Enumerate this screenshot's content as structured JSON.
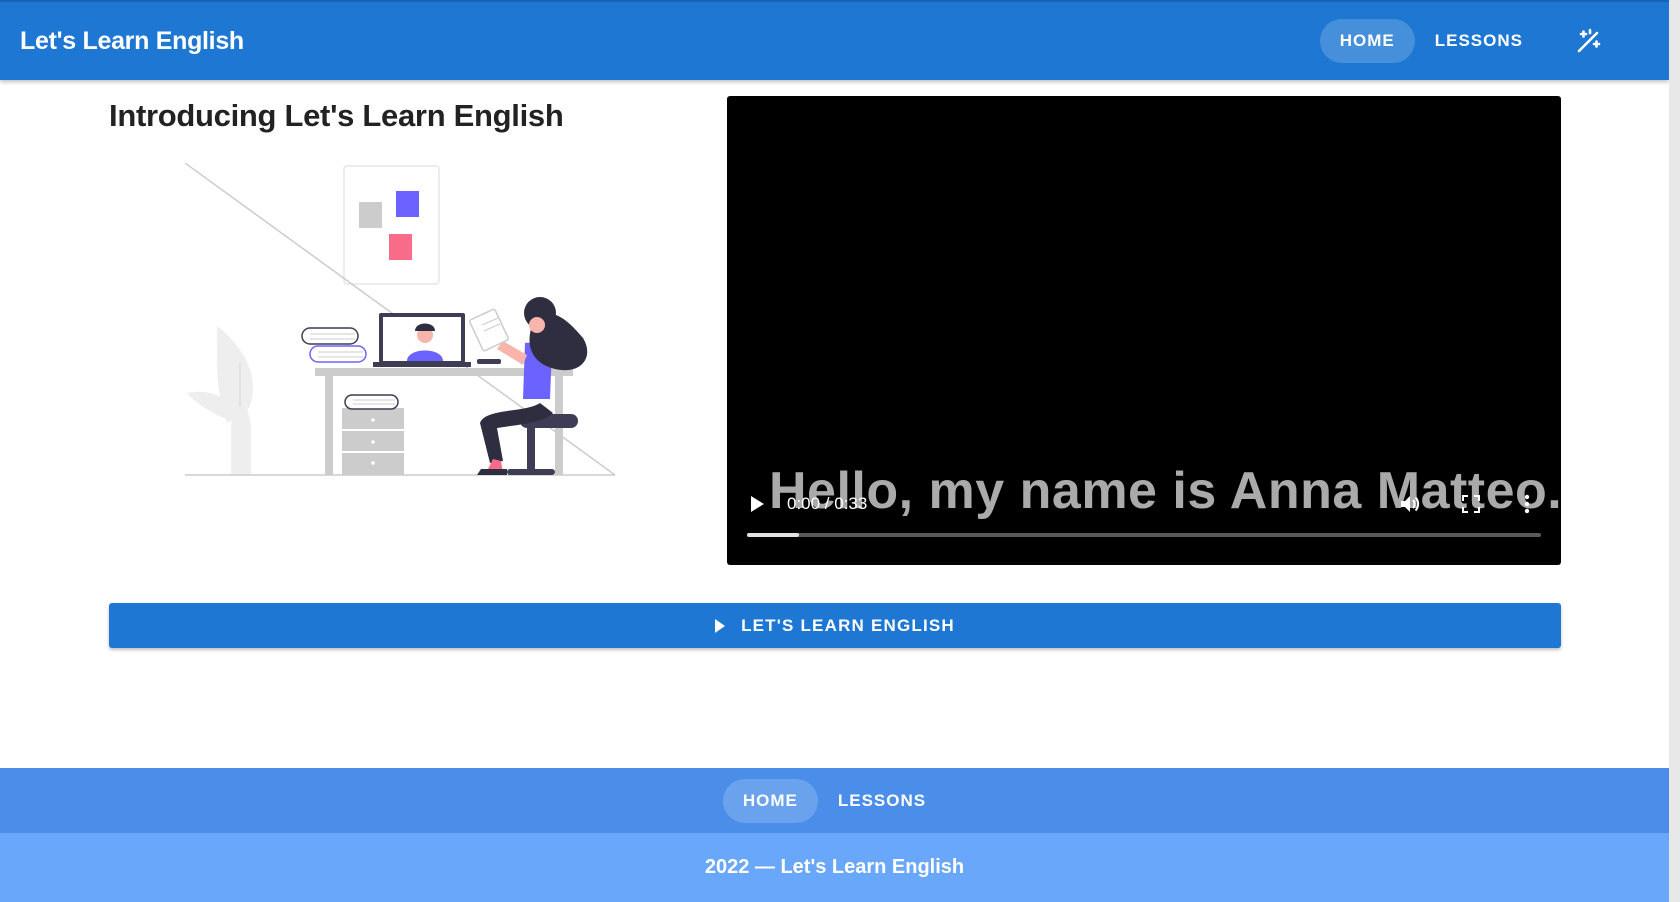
{
  "app": {
    "brand": "Let's Learn English"
  },
  "header": {
    "nav": [
      {
        "label": "HOME",
        "active": true
      },
      {
        "label": "LESSONS",
        "active": false
      }
    ],
    "theme_toggle_icon": "theme-toggle-icon"
  },
  "main": {
    "title": "Introducing Let's Learn English",
    "illustration_icon": "online-learning-illustration",
    "video": {
      "caption": "Hello, my name is Anna Matteo.",
      "time": "0:00 / 0:33",
      "buffered_fraction": 0.065,
      "controls": [
        "play-icon",
        "volume-icon",
        "fullscreen-icon",
        "more-options-icon"
      ]
    },
    "cta_label": "LET'S LEARN ENGLISH"
  },
  "footer": {
    "nav": [
      {
        "label": "HOME",
        "active": true
      },
      {
        "label": "LESSONS",
        "active": false
      }
    ],
    "copyright": "2022 — Let's Learn English"
  },
  "colors": {
    "primary": "#1e77d2",
    "footer_nav": "#4a8ee9",
    "footer_copy": "#69a7fb",
    "illustration_accent": "#6c63ff",
    "illustration_pink": "#f96c89"
  }
}
